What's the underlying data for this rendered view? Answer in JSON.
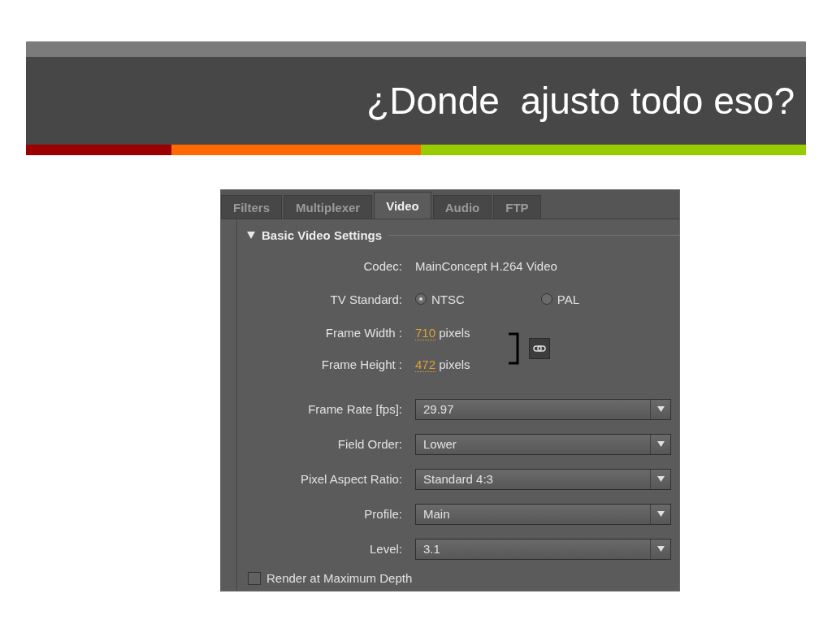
{
  "slide": {
    "title": "¿Donde  ajusto todo eso?"
  },
  "tabs": [
    {
      "label": "Filters",
      "selected": false
    },
    {
      "label": "Multiplexer",
      "selected": false
    },
    {
      "label": "Video",
      "selected": true
    },
    {
      "label": "Audio",
      "selected": false
    },
    {
      "label": "FTP",
      "selected": false
    }
  ],
  "section": {
    "title": "Basic Video Settings",
    "expanded": true
  },
  "codec": {
    "label": "Codec:",
    "value": "MainConcept H.264 Video"
  },
  "tv_standard": {
    "label": "TV Standard:",
    "options": [
      {
        "label": "NTSC",
        "selected": true
      },
      {
        "label": "PAL",
        "selected": false
      }
    ]
  },
  "frame_size": [
    {
      "label": "Frame Width :",
      "value": "710",
      "unit": "pixels"
    },
    {
      "label": "Frame Height :",
      "value": "472",
      "unit": "pixels"
    }
  ],
  "dropdowns": [
    {
      "label": "Frame Rate [fps]:",
      "value": "29.97"
    },
    {
      "label": "Field Order:",
      "value": "Lower"
    },
    {
      "label": "Pixel Aspect Ratio:",
      "value": "Standard 4:3"
    },
    {
      "label": "Profile:",
      "value": "Main"
    },
    {
      "label": "Level:",
      "value": "3.1"
    }
  ],
  "render_max_depth": {
    "label": "Render at Maximum Depth",
    "checked": false
  }
}
